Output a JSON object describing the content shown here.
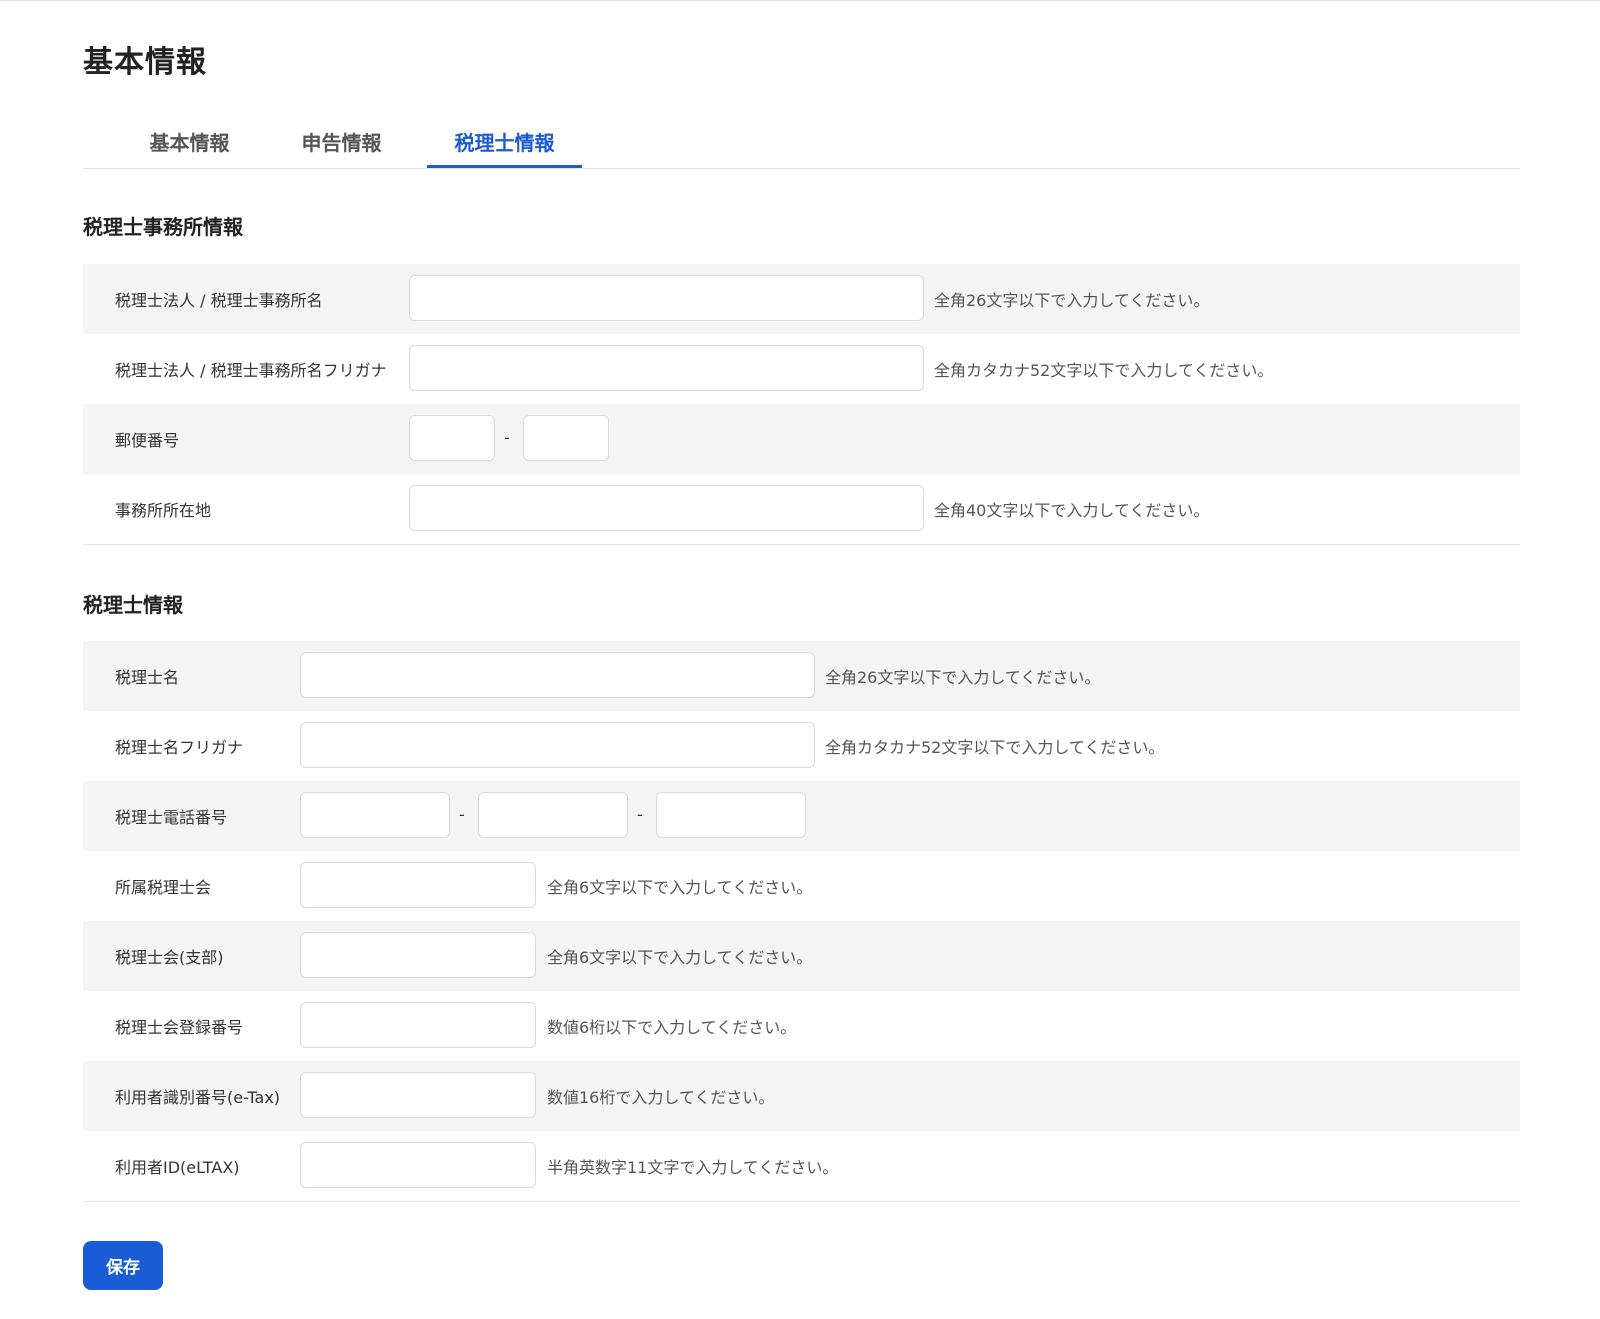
{
  "page_title": "基本情報",
  "tabs": [
    {
      "label": "基本情報",
      "active": false
    },
    {
      "label": "申告情報",
      "active": false
    },
    {
      "label": "税理士情報",
      "active": true
    }
  ],
  "office_section": {
    "title": "税理士事務所情報",
    "rows": {
      "office_name": {
        "label": "税理士法人 / 税理士事務所名",
        "value": "",
        "hint": "全角26文字以下で入力してください。"
      },
      "office_name_kana": {
        "label": "税理士法人 / 税理士事務所名フリガナ",
        "value": "",
        "hint": "全角カタカナ52文字以下で入力してください。"
      },
      "postal_code": {
        "label": "郵便番号",
        "part1": "",
        "part2": "",
        "separator": "-"
      },
      "office_address": {
        "label": "事務所所在地",
        "value": "",
        "hint": "全角40文字以下で入力してください。"
      }
    }
  },
  "accountant_section": {
    "title": "税理士情報",
    "rows": {
      "name": {
        "label": "税理士名",
        "value": "",
        "hint": "全角26文字以下で入力してください。"
      },
      "name_kana": {
        "label": "税理士名フリガナ",
        "value": "",
        "hint": "全角カタカナ52文字以下で入力してください。"
      },
      "phone": {
        "label": "税理士電話番号",
        "part1": "",
        "part2": "",
        "part3": "",
        "separator": "-"
      },
      "association": {
        "label": "所属税理士会",
        "value": "",
        "hint": "全角6文字以下で入力してください。"
      },
      "branch": {
        "label": "税理士会(支部)",
        "value": "",
        "hint": "全角6文字以下で入力してください。"
      },
      "registration_number": {
        "label": "税理士会登録番号",
        "value": "",
        "hint": "数値6桁以下で入力してください。"
      },
      "etax_id": {
        "label": "利用者識別番号(e-Tax)",
        "value": "",
        "hint": "数値16桁で入力してください。"
      },
      "eltax_id": {
        "label": "利用者ID(eLTAX)",
        "value": "",
        "hint": "半角英数字11文字で入力してください。"
      }
    }
  },
  "save_label": "保存",
  "colors": {
    "accent": "#1a5bd6",
    "row_shade": "#f5f4f4",
    "border": "#d9d9d9"
  }
}
